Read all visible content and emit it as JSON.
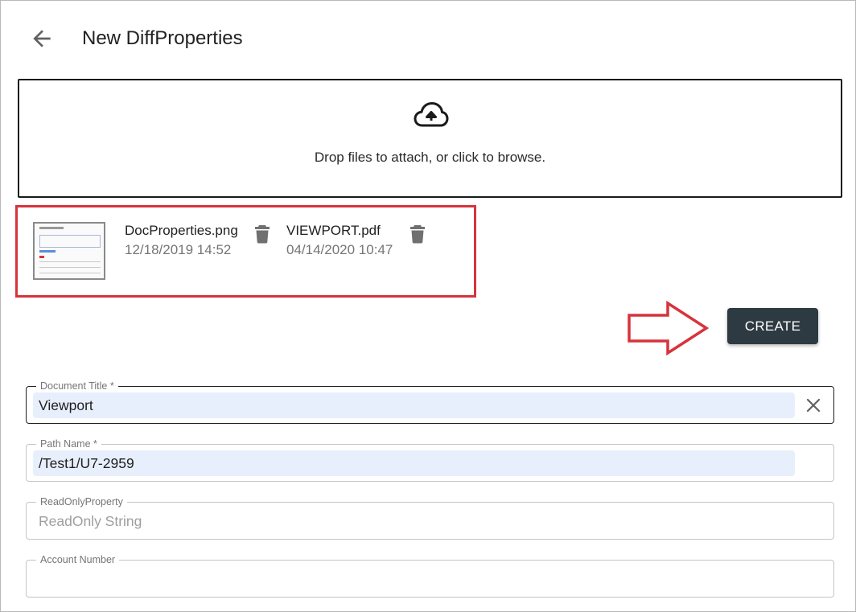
{
  "header": {
    "title": "New DiffProperties",
    "back_icon": "arrow-left-icon"
  },
  "dropzone": {
    "icon": "cloud-upload-icon",
    "text": "Drop files to attach, or click to browse."
  },
  "attachments": [
    {
      "name": "DocProperties.png",
      "date": "12/18/2019 14:52",
      "has_thumbnail": true,
      "delete_icon": "trash-icon"
    },
    {
      "name": "VIEWPORT.pdf",
      "date": "04/14/2020 10:47",
      "has_thumbnail": false,
      "delete_icon": "trash-icon"
    }
  ],
  "annotation": {
    "highlight_color": "#d7333d",
    "arrow_color": "#d7333d"
  },
  "actions": {
    "create_label": "CREATE",
    "create_color": "#2d3a42"
  },
  "form": {
    "document_title": {
      "label": "Document Title *",
      "value": "Viewport",
      "clear_icon": "close-icon"
    },
    "path_name": {
      "label": "Path Name *",
      "value": "/Test1/U7-2959"
    },
    "read_only_property": {
      "label": "ReadOnlyProperty",
      "value": "ReadOnly String"
    },
    "account_number": {
      "label": "Account Number",
      "value": ""
    }
  },
  "colors": {
    "autofill_bg": "#e8effc"
  }
}
